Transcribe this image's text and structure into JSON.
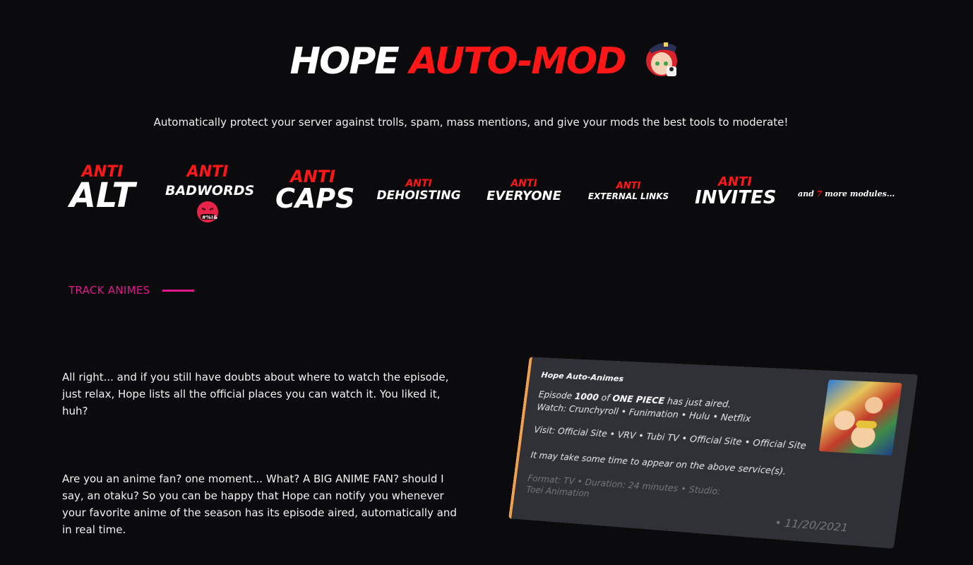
{
  "hero": {
    "title_white": "HOPE ",
    "title_red": "AUTO-MOD",
    "subtitle": "Automatically protect your server against trolls, spam, mass mentions, and give your mods the best tools to moderate!"
  },
  "modules": {
    "prefix": "ANTI",
    "items": [
      {
        "name": "ALT"
      },
      {
        "name": "BADWORDS",
        "emoji_text": "#%!&"
      },
      {
        "name": "CAPS"
      },
      {
        "name": "DEHOISTING"
      },
      {
        "name": "EVERYONE"
      },
      {
        "name": "EXTERNAL LINKS"
      },
      {
        "name": "INVITES"
      }
    ],
    "more_prefix": "and ",
    "more_count": "7",
    "more_suffix": " more modules..."
  },
  "section": {
    "label": "TRACK ANIMES"
  },
  "paragraphs": [
    "All right... and if you still have doubts about where to watch the episode, just relax, Hope lists all the official places you can watch it. You liked it, huh?",
    "Are you an anime fan? one moment... What? A BIG ANIME FAN? should I say, an otaku? So you can be happy that Hope can notify you whenever your favorite anime of the season has its episode aired, automatically and in real time."
  ],
  "card": {
    "title": "Hope Auto-Animes",
    "episode_prefix": "Episode ",
    "episode_number": "1000",
    "episode_mid": " of ",
    "anime_name": "ONE PIECE",
    "episode_suffix": " has just aired.",
    "watch_line": "Watch: Crunchyroll • Funimation • Hulu • Netflix",
    "visit_line": "Visit: Official Site • VRV • Tubi TV • Official Site • Official Site",
    "note": "It may take some time to appear on the above service(s).",
    "footer": "Format: TV • Duration: 24 minutes • Studio: Toei Animation",
    "date": "•  11/20/2021",
    "accent_color": "#f0a050"
  },
  "colors": {
    "background": "#0b0b0e",
    "accent_red": "#ff1616",
    "section_pink": "#e0188c"
  }
}
